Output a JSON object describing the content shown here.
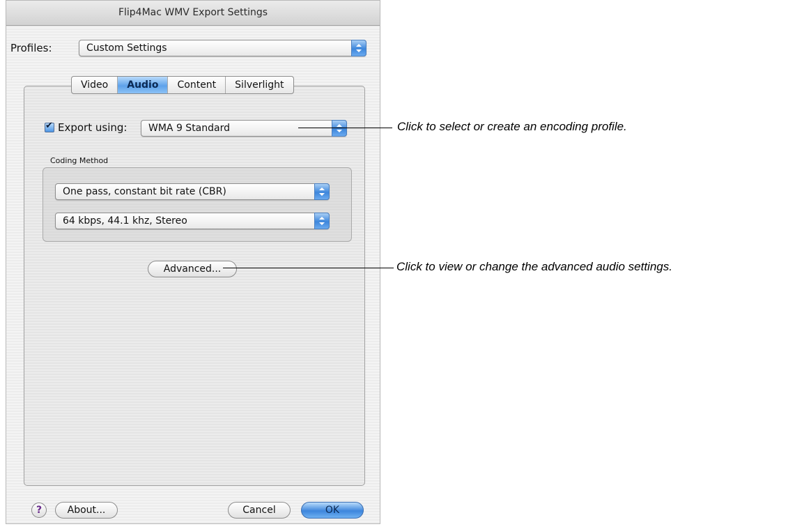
{
  "window": {
    "title": "Flip4Mac WMV Export Settings"
  },
  "profiles": {
    "label": "Profiles:",
    "selected": "Custom Settings"
  },
  "tabs": [
    {
      "label": "Video",
      "active": false
    },
    {
      "label": "Audio",
      "active": true
    },
    {
      "label": "Content",
      "active": false
    },
    {
      "label": "Silverlight",
      "active": false
    }
  ],
  "audio": {
    "export_checkbox_label": "Export using:",
    "export_checked": true,
    "export_codec": "WMA 9 Standard",
    "coding_method_label": "Coding Method",
    "coding_method": "One pass, constant bit rate (CBR)",
    "bitrate": "64 kbps, 44.1 khz, Stereo",
    "advanced_button": "Advanced..."
  },
  "footer": {
    "help": "?",
    "about_button": "About...",
    "cancel_button": "Cancel",
    "ok_button": "OK"
  },
  "callouts": {
    "encoding_profile": "Click to select or create an encoding profile.",
    "advanced_audio": "Click to view or change the advanced audio settings."
  },
  "colors": {
    "accent_blue": "#3d86dc",
    "window_bg": "#ececec"
  }
}
